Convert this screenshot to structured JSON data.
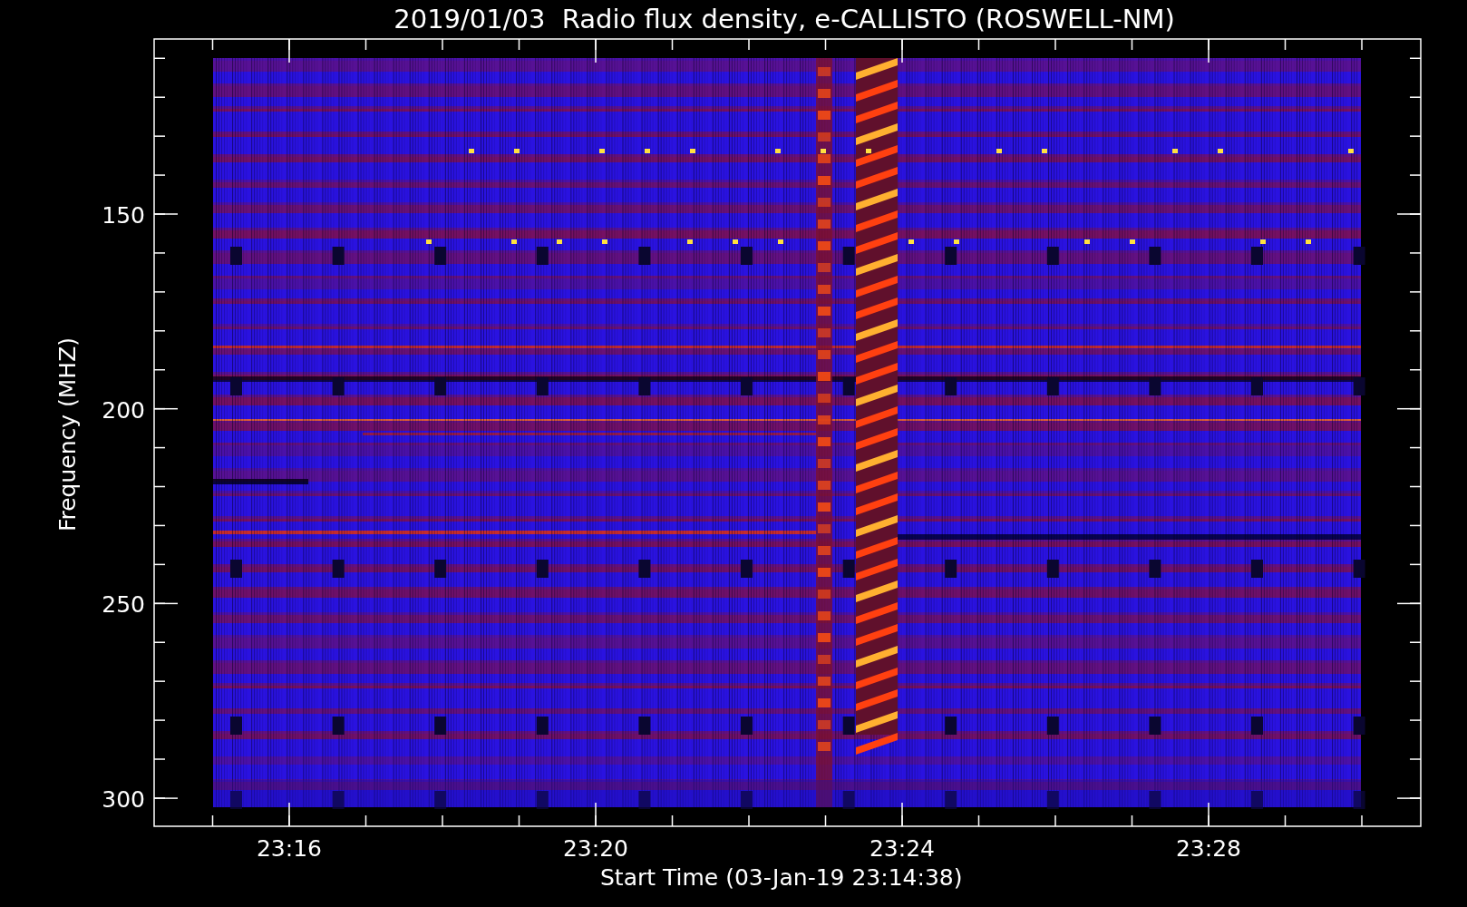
{
  "plot": {
    "title": "2019/01/03  Radio flux density, e-CALLISTO (ROSWELL-NM)",
    "ylabel": "Frequency (MHZ)",
    "xlabel": "Start Time (03-Jan-19 23:14:38)",
    "y_tick_labels": [
      "150",
      "200",
      "250",
      "300"
    ],
    "x_tick_labels": [
      "23:16",
      "23:20",
      "23:24",
      "23:28"
    ]
  }
}
